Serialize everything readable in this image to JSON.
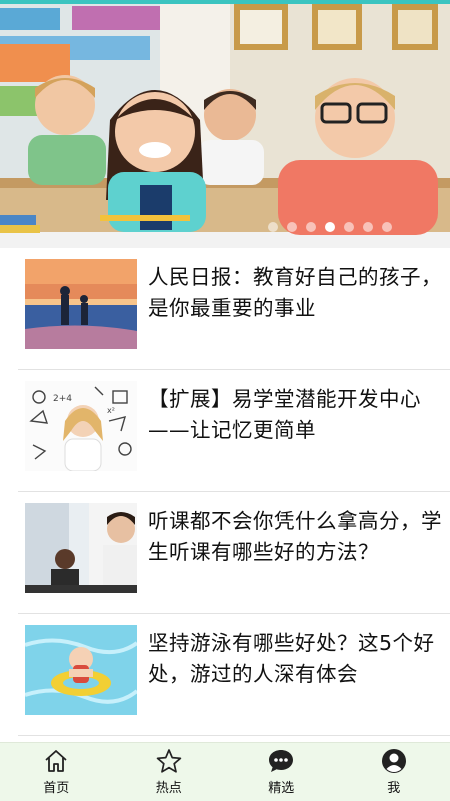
{
  "banner": {
    "image": "classroom-children-smiling",
    "carousel_dots": 7,
    "active_dot": 3,
    "accent_color": "#3bc4c0"
  },
  "news": [
    {
      "title": "人民日报：教育好自己的孩子，是你最重要的事业",
      "thumb": "family-lake-sunset"
    },
    {
      "title": "【扩展】易学堂潜能开发中心——让记忆更简单",
      "thumb": "girl-thinking-doodles"
    },
    {
      "title": "听课都不会你凭什么拿高分，学生听课有哪些好的方法？",
      "thumb": "students-classroom"
    },
    {
      "title": "坚持游泳有哪些好处？这5个好处，游过的人深有体会",
      "thumb": "child-swimming-pool"
    }
  ],
  "tabs": [
    {
      "label": "首页",
      "icon": "home-icon"
    },
    {
      "label": "热点",
      "icon": "star-icon"
    },
    {
      "label": "精选",
      "icon": "chat-bubble-icon"
    },
    {
      "label": "我",
      "icon": "user-icon"
    }
  ],
  "colors": {
    "tabbar_bg": "#eef8ea",
    "text": "#111111"
  }
}
